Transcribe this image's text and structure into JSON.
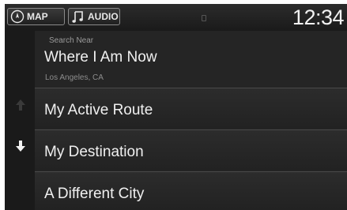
{
  "topbar": {
    "map_label": "MAP",
    "audio_label": "AUDIO",
    "map_icon": "compass-icon",
    "audio_icon": "music-note-icon",
    "clock": "12:34"
  },
  "list": {
    "caption": "Search Near",
    "items": [
      {
        "label": "Where I Am Now",
        "sublabel": "Los Angeles, CA"
      },
      {
        "label": "My Active Route"
      },
      {
        "label": "My Destination"
      },
      {
        "label": "A Different City"
      }
    ]
  },
  "colors": {
    "background": "#1c1c1c",
    "text": "#f0f0f0",
    "muted_text": "#8d8d8d",
    "divider": "#4a4a4a"
  }
}
